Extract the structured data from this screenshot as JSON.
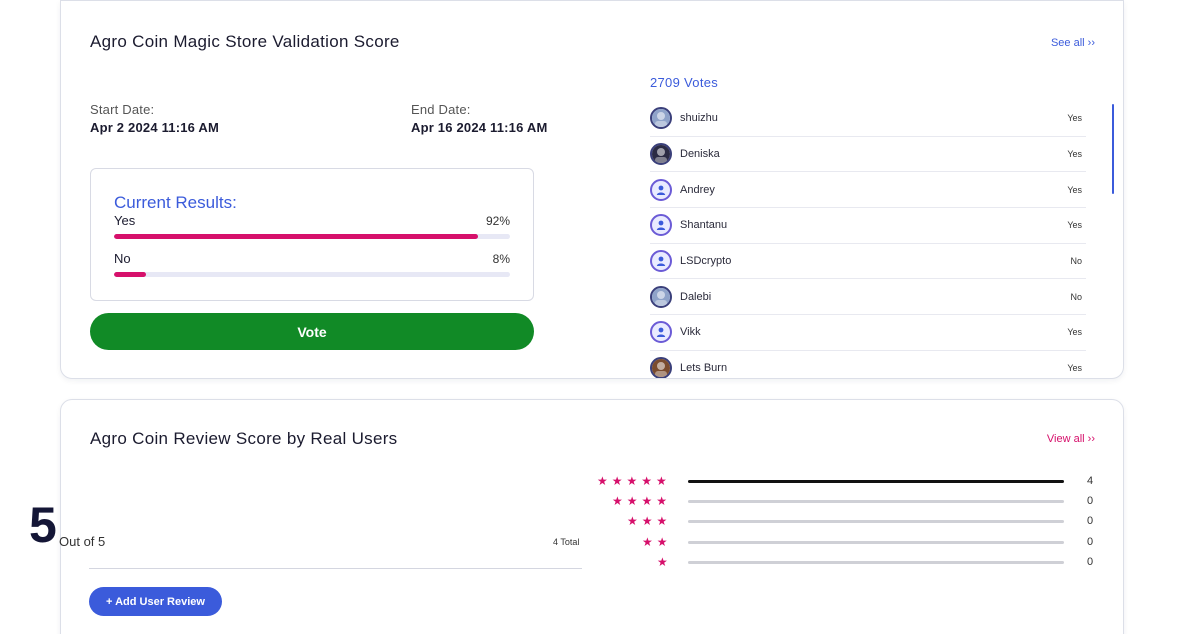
{
  "validation": {
    "title": "Agro Coin Magic Store Validation Score",
    "see_all": "See all ››",
    "start_label": "Start Date:",
    "start_value": "Apr 2 2024 11:16 AM",
    "end_label": "End Date:",
    "end_value": "Apr 16 2024 11:16 AM",
    "results_title": "Current Results:",
    "options": [
      {
        "label": "Yes",
        "percent_text": "92%",
        "percent": 92
      },
      {
        "label": "No",
        "percent_text": "8%",
        "percent": 8
      }
    ],
    "vote_button": "Vote",
    "votes_count": "2709 Votes",
    "voters": [
      {
        "name": "shuizhu",
        "answer": "Yes",
        "avatar": "photo"
      },
      {
        "name": "Deniska",
        "answer": "Yes",
        "avatar": "photo"
      },
      {
        "name": "Andrey",
        "answer": "Yes",
        "avatar": "default-user-icon"
      },
      {
        "name": "Shantanu",
        "answer": "Yes",
        "avatar": "default-user-icon"
      },
      {
        "name": "LSDcrypto",
        "answer": "No",
        "avatar": "default-user-icon"
      },
      {
        "name": "Dalebi",
        "answer": "No",
        "avatar": "photo"
      },
      {
        "name": "Vikk",
        "answer": "Yes",
        "avatar": "default-user-icon"
      },
      {
        "name": "Lets Burn",
        "answer": "Yes",
        "avatar": "photo"
      }
    ]
  },
  "reviews": {
    "title": "Agro Coin Review Score by Real Users",
    "view_all": "View all ››",
    "score": "5",
    "out_of": "Out of 5",
    "total": "4 Total",
    "add_review": "+ Add User Review",
    "breakdown": [
      {
        "stars": 5,
        "count": "4",
        "fraction": 1.0
      },
      {
        "stars": 4,
        "count": "0",
        "fraction": 0
      },
      {
        "stars": 3,
        "count": "0",
        "fraction": 0
      },
      {
        "stars": 2,
        "count": "0",
        "fraction": 0
      },
      {
        "stars": 1,
        "count": "0",
        "fraction": 0
      }
    ]
  },
  "colors": {
    "accent": "#3b5bdb",
    "bar_pink": "#d6106b",
    "vote_green": "#118a26",
    "star": "#d6106b"
  }
}
